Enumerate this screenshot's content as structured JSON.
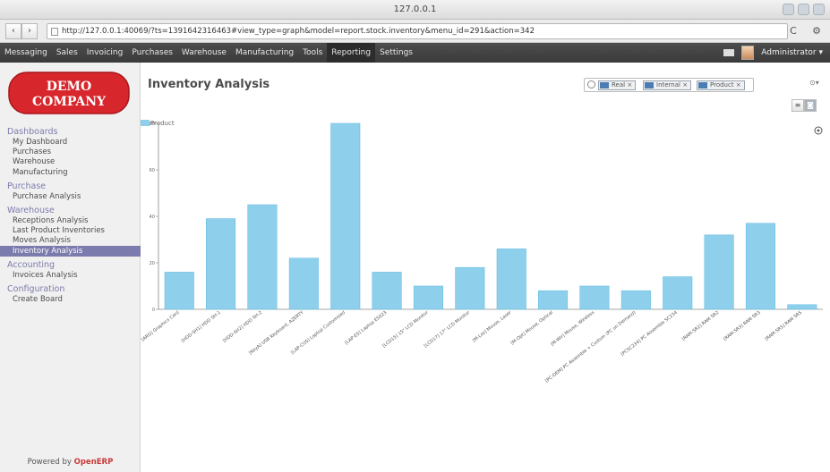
{
  "window": {
    "title": "127.0.0.1"
  },
  "browser": {
    "back": "‹",
    "forward": "›",
    "url": "http://127.0.0.1:40069/?ts=1391642316463#view_type=graph&model=report.stock.inventory&menu_id=291&action=342",
    "reload": "C",
    "menu": "⚙"
  },
  "topmenu": {
    "items": [
      "Messaging",
      "Sales",
      "Invoicing",
      "Purchases",
      "Warehouse",
      "Manufacturing",
      "Tools",
      "Reporting",
      "Settings"
    ],
    "active": "Reporting",
    "user": "Administrator ▾"
  },
  "sidebar": {
    "logo_line1": "DEMO",
    "logo_line2": "COMPANY",
    "sections": [
      {
        "title": "Dashboards",
        "items": [
          "My Dashboard",
          "Purchases",
          "Warehouse",
          "Manufacturing"
        ]
      },
      {
        "title": "Purchase",
        "items": [
          "Purchase Analysis"
        ]
      },
      {
        "title": "Warehouse",
        "items": [
          "Receptions Analysis",
          "Last Product Inventories",
          "Moves Analysis",
          "Inventory Analysis"
        ]
      },
      {
        "title": "Accounting",
        "items": [
          "Invoices Analysis"
        ]
      },
      {
        "title": "Configuration",
        "items": [
          "Create Board"
        ]
      }
    ],
    "active_item": "Inventory Analysis",
    "powered_prefix": "Powered by ",
    "powered_brand": "OpenERP"
  },
  "main": {
    "title": "Inventory Analysis",
    "search": {
      "facets": [
        "Real ×",
        "Internal ×",
        "Product ×"
      ],
      "extra": "⊙▾"
    },
    "view_buttons": [
      "≡",
      "◙"
    ],
    "chart_option_icon": "⊙"
  },
  "colors": {
    "bar": "#8ed0ec",
    "bar_edge": "#6cbfe3",
    "accent": "#7c7bad"
  },
  "chart_data": {
    "type": "bar",
    "legend": [
      "Product"
    ],
    "legend_placement": "top-left",
    "grid": false,
    "ylim": [
      0,
      80
    ],
    "yticks": [
      0,
      20,
      40,
      60,
      80
    ],
    "categories": [
      "[ARG] Graphics Card",
      "[HDD-SH1] HDD SH-1",
      "[HDD-SH2] HDD SH-2",
      "[KeyA] USB Keyboard, AZERTY",
      "[LAP-CUS] Laptop Customized",
      "[LAP-E5] Laptop E5023",
      "[LCD15] 15\" LCD Monitor",
      "[LCD17] 17\" LCD Monitor",
      "[M-Las] Mouse, Laser",
      "[M-Opt] Mouse, Optical",
      "[M-Wir] Mouse, Wireless",
      "[PC-DEM] PC Assemble + Custom (PC on Demand)",
      "[PCSC234] PC Assemble SC234",
      "[RAM-SR2] RAM SR2",
      "[RAM-SR3] RAM SR3",
      "[RAM-SR5] RAM SR5"
    ],
    "values": [
      16,
      39,
      45,
      22,
      80,
      16,
      10,
      18,
      26,
      8,
      10,
      8,
      14,
      32,
      37,
      2
    ]
  }
}
